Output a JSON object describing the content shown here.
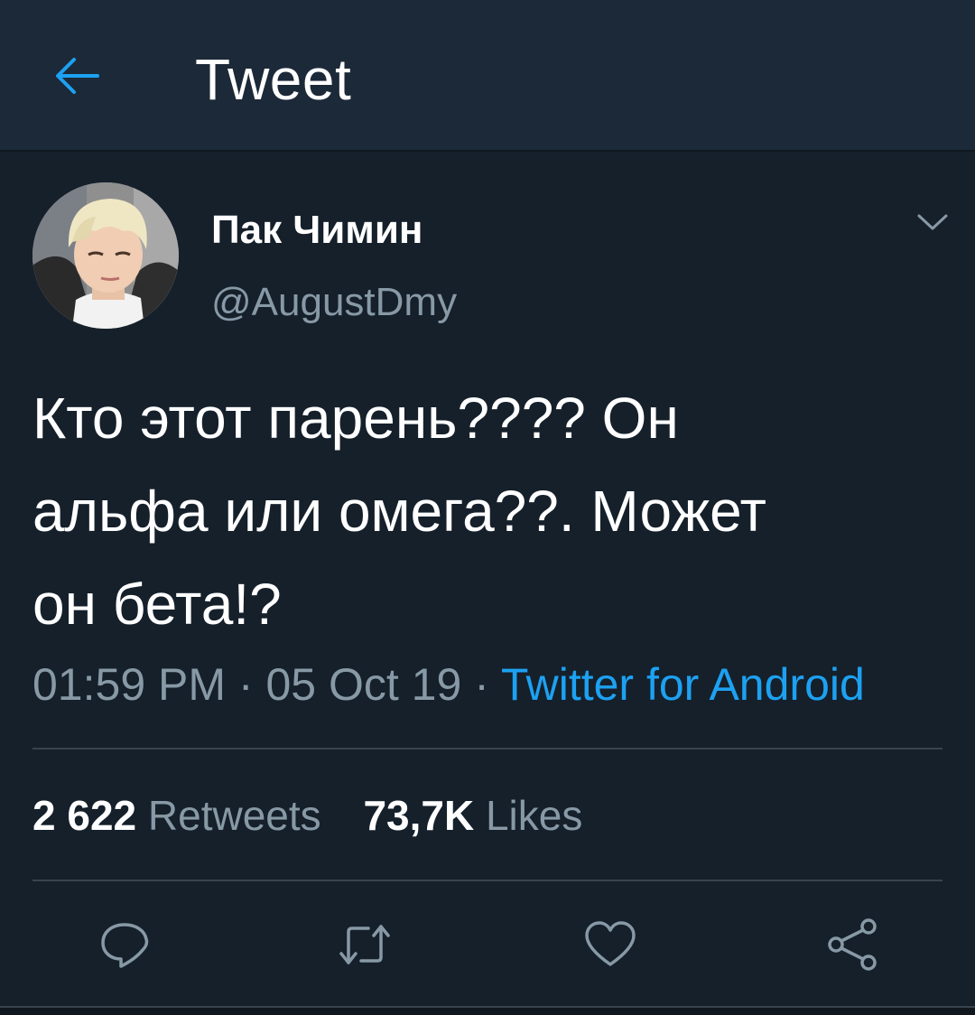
{
  "header": {
    "title": "Tweet",
    "back_icon": "back-arrow-icon"
  },
  "author": {
    "display_name": "Пак Чимин",
    "handle": "@AugustDmy"
  },
  "tweet": {
    "text": "Кто этот парень???? Он\nальфа или омега??. Может\nон бета!?",
    "time": "01:59 PM",
    "separator": "·",
    "date": "05 Oct 19",
    "source": "Twitter for Android"
  },
  "stats": {
    "retweets_count": "2 622",
    "retweets_label": "Retweets",
    "likes_count": "73,7K",
    "likes_label": "Likes"
  },
  "actions": {
    "reply_icon": "reply-icon",
    "retweet_icon": "retweet-icon",
    "like_icon": "heart-icon",
    "share_icon": "share-icon"
  },
  "colors": {
    "background": "#15202b",
    "header_background": "#1c2938",
    "accent": "#1da1f2",
    "secondary_text": "#8899a6",
    "divider": "#38444d"
  }
}
